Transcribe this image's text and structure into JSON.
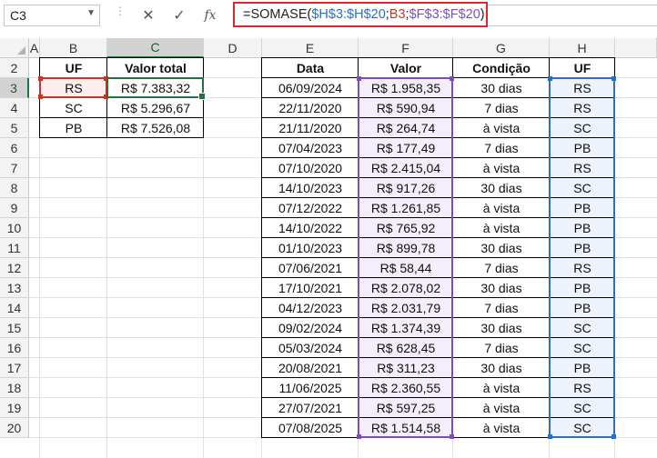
{
  "name_box": {
    "value": "C3"
  },
  "formula_bar": {
    "prefix": "=SOMASE(",
    "range_uf": "$H$3:$H$20",
    "sep1": ";",
    "criteria": "B3",
    "sep2": ";",
    "range_sum": "$F$3:$F$20",
    "suffix": ")",
    "cancel_icon": "cross-icon",
    "enter_icon": "check-icon",
    "function_icon": "fx-icon",
    "fx_label": "fx"
  },
  "colors": {
    "selection_green": "#217346",
    "ref_uf": "#2e6fba",
    "ref_criteria": "#c0392b",
    "ref_sum": "#7d4fb3",
    "formula_border": "#d62a2a"
  },
  "columns": [
    "A",
    "B",
    "C",
    "D",
    "E",
    "F",
    "G",
    "H"
  ],
  "rows": [
    "2",
    "3",
    "4",
    "5",
    "6",
    "7",
    "8",
    "9",
    "10",
    "11",
    "12",
    "13",
    "14",
    "15",
    "16",
    "17",
    "18",
    "19",
    "20"
  ],
  "summary": {
    "headers": {
      "uf": "UF",
      "valor_total": "Valor total"
    },
    "rows": [
      {
        "uf": "RS",
        "valor_total": "R$ 7.383,32"
      },
      {
        "uf": "SC",
        "valor_total": "R$ 5.296,67"
      },
      {
        "uf": "PB",
        "valor_total": "R$ 7.526,08"
      }
    ]
  },
  "data_table": {
    "headers": {
      "data": "Data",
      "valor": "Valor",
      "condicao": "Condição",
      "uf": "UF"
    },
    "rows": [
      {
        "data": "06/09/2024",
        "valor": "R$ 1.958,35",
        "condicao": "30 dias",
        "uf": "RS"
      },
      {
        "data": "22/11/2020",
        "valor": "R$ 590,94",
        "condicao": "7 dias",
        "uf": "RS"
      },
      {
        "data": "21/11/2020",
        "valor": "R$ 264,74",
        "condicao": "à vista",
        "uf": "SC"
      },
      {
        "data": "07/04/2023",
        "valor": "R$ 177,49",
        "condicao": "7 dias",
        "uf": "PB"
      },
      {
        "data": "07/10/2020",
        "valor": "R$ 2.415,04",
        "condicao": "à vista",
        "uf": "RS"
      },
      {
        "data": "14/10/2023",
        "valor": "R$ 917,26",
        "condicao": "30 dias",
        "uf": "SC"
      },
      {
        "data": "07/12/2022",
        "valor": "R$ 1.261,85",
        "condicao": "à vista",
        "uf": "PB"
      },
      {
        "data": "14/10/2022",
        "valor": "R$ 765,92",
        "condicao": "à vista",
        "uf": "PB"
      },
      {
        "data": "01/10/2023",
        "valor": "R$ 899,78",
        "condicao": "30 dias",
        "uf": "PB"
      },
      {
        "data": "07/06/2021",
        "valor": "R$ 58,44",
        "condicao": "7 dias",
        "uf": "RS"
      },
      {
        "data": "17/10/2021",
        "valor": "R$ 2.078,02",
        "condicao": "30 dias",
        "uf": "PB"
      },
      {
        "data": "04/12/2023",
        "valor": "R$ 2.031,79",
        "condicao": "7 dias",
        "uf": "PB"
      },
      {
        "data": "09/02/2024",
        "valor": "R$ 1.374,39",
        "condicao": "30 dias",
        "uf": "SC"
      },
      {
        "data": "05/03/2024",
        "valor": "R$ 628,45",
        "condicao": "7 dias",
        "uf": "SC"
      },
      {
        "data": "20/08/2021",
        "valor": "R$ 311,23",
        "condicao": "30 dias",
        "uf": "PB"
      },
      {
        "data": "11/06/2025",
        "valor": "R$ 2.360,55",
        "condicao": "à vista",
        "uf": "RS"
      },
      {
        "data": "27/07/2021",
        "valor": "R$ 597,25",
        "condicao": "à vista",
        "uf": "SC"
      },
      {
        "data": "07/08/2025",
        "valor": "R$ 1.514,58",
        "condicao": "à vista",
        "uf": "SC"
      }
    ]
  }
}
